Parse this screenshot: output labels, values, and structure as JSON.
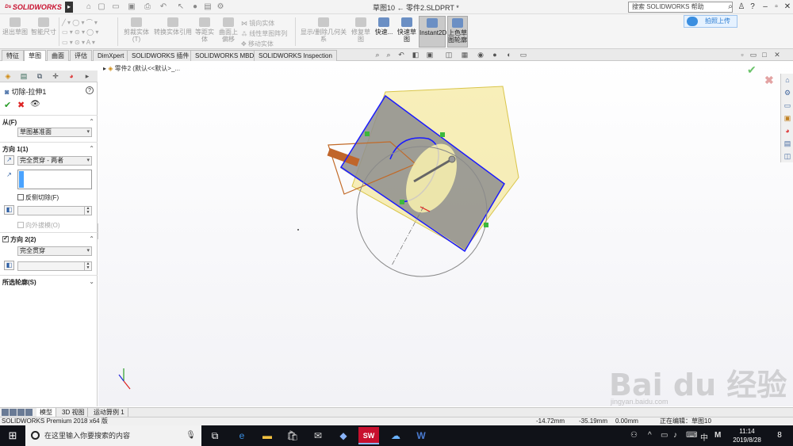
{
  "app": {
    "logo_text": "SOLIDWORKS",
    "doc_title": "草图10 ← 零件2.SLDPRT *",
    "help_search_placeholder": "搜索 SOLIDWORKS 帮助",
    "upload_label": "拍照上传"
  },
  "ribbon": {
    "exit_sketch": "退出草图",
    "smart_dimension": "智能尺寸",
    "trim_entities": "剪裁实体(T)",
    "convert_entities": "转换实体引用",
    "offset_entities": "等距实体",
    "surface_offset": "曲面上偏移",
    "mirror_entities": "镜向实体",
    "linear_pattern": "线性草图阵列",
    "move_entities": "移动实体",
    "display_relations": "显示/删除几何关系",
    "repair_sketch": "修复草图",
    "quick_snaps": "快速...",
    "rapid_sketch": "快速草图",
    "instant2d": "Instant2D",
    "shaded_contours": "上色草图轮廓"
  },
  "tabs": [
    "特征",
    "草图",
    "曲面",
    "评估",
    "DimXpert",
    "SOLIDWORKS 插件",
    "SOLIDWORKS MBD",
    "SOLIDWORKS Inspection"
  ],
  "active_tab": "草图",
  "tree_path": "零件2 (默认<<默认>_...",
  "property_manager": {
    "title": "切除-拉伸1",
    "from_label": "从(F)",
    "from_value": "草图基准面",
    "dir1_label": "方向 1(1)",
    "dir1_end_condition": "完全贯穿 - 两者",
    "flip_side": "反侧切除(F)",
    "draft_outward": "向外拔模(O)",
    "dir2_label": "方向 2(2)",
    "dir2_end_condition": "完全贯穿",
    "selected_contours": "所选轮廓(S)"
  },
  "bottom_tabs": [
    "模型",
    "3D 视图",
    "运动算例 1"
  ],
  "status": {
    "product": "SOLIDWORKS Premium 2018 x64 版",
    "x": "-14.72mm",
    "y": "-35.19mm",
    "z": "0.00mm",
    "state": "正在编辑：草图10"
  },
  "taskbar": {
    "search_placeholder": "在这里输入你要搜索的内容",
    "ime": "中",
    "time": "11:14",
    "date": "2019/8/28",
    "notifications": "8"
  },
  "watermark": {
    "brand": "Bai du 经验",
    "url": "jingyan.baidu.com"
  },
  "colors": {
    "brand_red": "#c8102e",
    "sketch_blue": "#1a1aff",
    "part_yellow": "#f4e58a",
    "taskbar": "#101218"
  }
}
